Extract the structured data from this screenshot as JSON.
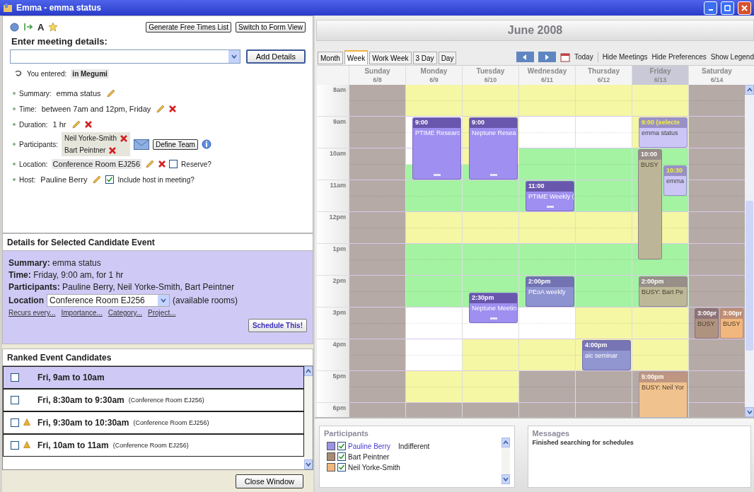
{
  "window": {
    "title": "Emma - emma status"
  },
  "toolbar": {
    "glyph": "A",
    "buttons": [
      "Generate Free Times List",
      "Switch to Form View"
    ]
  },
  "entry": {
    "heading": "Enter meeting details:",
    "button": "Add Details",
    "echo_label": "You entered:",
    "echo_value": "in Megumi"
  },
  "fields": [
    {
      "kind": "text",
      "label": "Summary:",
      "value": "emma status",
      "removable": false
    },
    {
      "kind": "text",
      "label": "Time:",
      "value": "between 7am and 12pm, Friday",
      "removable": true
    },
    {
      "kind": "text",
      "label": "Duration:",
      "value": "1 hr",
      "removable": true
    },
    {
      "kind": "participants",
      "label": "Participants:",
      "names": [
        "Neil Yorke-Smith",
        "Bart Peintner"
      ],
      "button": "Define Team"
    },
    {
      "kind": "location",
      "label": "Location:",
      "value": "Conference Room EJ256",
      "removable": true,
      "option": {
        "label": "Reserve?",
        "checked": false
      }
    },
    {
      "kind": "host",
      "label": "Host:",
      "value": "Pauline Berry",
      "removable": false,
      "option": {
        "label": "Include host in meeting?",
        "checked": true
      }
    }
  ],
  "details": {
    "title": "Details for Selected Candidate Event",
    "lines": [
      {
        "label": "Summary:",
        "value": "emma status"
      },
      {
        "label": "Time:",
        "value": "Friday, 9:00 am, for 1 hr"
      },
      {
        "label": "Participants:",
        "value": "Pauline Berry, Neil Yorke-Smith, Bart Peintner"
      }
    ],
    "location": {
      "label": "Location",
      "value": "Conference Room EJ256",
      "note": "(available rooms)"
    },
    "links": [
      "Recurs every...",
      "Importance...",
      "Category...",
      "Project..."
    ],
    "button": "Schedule This!"
  },
  "candidates": {
    "title": "Ranked Event Candidates",
    "items": [
      {
        "time": "Fri, 9am to 10am",
        "checked": false,
        "warning": false,
        "selected": true
      },
      {
        "time": "Fri, 8:30am to 9:30am",
        "room": "(Conference Room EJ256)",
        "checked": false,
        "warning": false,
        "selected": false
      },
      {
        "time": "Fri, 9:30am to 10:30am",
        "room": "(Conference Room EJ256)",
        "checked": false,
        "warning": true,
        "selected": false
      },
      {
        "time": "Fri, 10am to 11am",
        "room": "(Conference Room EJ256)",
        "checked": false,
        "warning": true,
        "selected": false
      }
    ],
    "button": "Close Window"
  },
  "calendar": {
    "title": "June 2008",
    "views": [
      {
        "label": "Month",
        "selected": false
      },
      {
        "label": "Week",
        "selected": true
      },
      {
        "label": "Work Week",
        "selected": false
      },
      {
        "label": "3 Day",
        "selected": false
      },
      {
        "label": "Day",
        "selected": false
      }
    ],
    "today": "Today",
    "actions": [
      "Hide Meetings",
      "Hide Preferences",
      "Show Legend"
    ],
    "hours": [
      "8am",
      "9am",
      "10am",
      "11am",
      "12pm",
      "1pm",
      "2pm",
      "3pm",
      "4pm",
      "5pm",
      "6pm"
    ],
    "days": [
      {
        "name": "Sunday",
        "date": "6/8",
        "selected": false,
        "slots": [
          {
            "kind": "unavailable"
          },
          {
            "kind": "unavailable"
          },
          {
            "kind": "unavailable"
          },
          {
            "kind": "unavailable"
          },
          {
            "kind": "unavailable"
          },
          {
            "kind": "unavailable"
          },
          {
            "kind": "unavailable"
          },
          {
            "kind": "unavailable"
          },
          {
            "kind": "unavailable"
          },
          {
            "kind": "unavailable"
          },
          {
            "kind": "unavailable"
          },
          {
            "kind": "unavailable"
          },
          {
            "kind": "unavailable"
          },
          {
            "kind": "unavailable"
          },
          {
            "kind": "unavailable"
          },
          {
            "kind": "unavailable"
          },
          {
            "kind": "unavailable"
          },
          {
            "kind": "unavailable"
          },
          {
            "kind": "unavailable"
          },
          {
            "kind": "unavailable"
          },
          {
            "kind": "unavailable"
          }
        ]
      },
      {
        "name": "Monday",
        "date": "6/9",
        "selected": false,
        "slots": [
          {
            "kind": "acceptable"
          },
          {
            "kind": "acceptable"
          },
          {
            "kind": "open",
            "events": [
              {
                "kind": "meeting",
                "time": "9:00",
                "text": "PTIME Researc",
                "color": "#9e8ff0"
              }
            ]
          },
          {
            "kind": "open",
            "events": [
              {
                "kind": "continued"
              }
            ]
          },
          {
            "kind": "open",
            "events": [
              {
                "kind": "continued"
              }
            ]
          },
          {
            "kind": "preferred",
            "events": [
              {
                "kind": "continued"
              }
            ]
          },
          {
            "kind": "preferred"
          },
          {
            "kind": "preferred"
          },
          {
            "kind": "acceptable"
          },
          {
            "kind": "acceptable"
          },
          {
            "kind": "preferred"
          },
          {
            "kind": "preferred"
          },
          {
            "kind": "preferred"
          },
          {
            "kind": "preferred"
          },
          {
            "kind": "open"
          },
          {
            "kind": "open"
          },
          {
            "kind": "open"
          },
          {
            "kind": "open"
          },
          {
            "kind": "acceptable"
          },
          {
            "kind": "acceptable"
          },
          {
            "kind": "unavailable"
          }
        ]
      },
      {
        "name": "Tuesday",
        "date": "6/10",
        "selected": false,
        "slots": [
          {
            "kind": "acceptable"
          },
          {
            "kind": "acceptable"
          },
          {
            "kind": "acceptable",
            "events": [
              {
                "kind": "meeting",
                "time": "9:00",
                "text": "Neptune Resea",
                "color": "#9e8ff0"
              }
            ]
          },
          {
            "kind": "acceptable",
            "events": [
              {
                "kind": "continued"
              }
            ]
          },
          {
            "kind": "acceptable",
            "events": [
              {
                "kind": "continued"
              }
            ]
          },
          {
            "kind": "preferred",
            "events": [
              {
                "kind": "continued"
              }
            ]
          },
          {
            "kind": "preferred"
          },
          {
            "kind": "preferred"
          },
          {
            "kind": "acceptable"
          },
          {
            "kind": "acceptable"
          },
          {
            "kind": "preferred"
          },
          {
            "kind": "preferred"
          },
          {
            "kind": "preferred"
          },
          {
            "kind": "preferred",
            "events": [
              {
                "kind": "meeting",
                "time": "2:30pm",
                "text": "Neptune Meetin",
                "color": "#9e8ff0"
              }
            ]
          },
          {
            "kind": "open",
            "events": [
              {
                "kind": "continued"
              }
            ]
          },
          {
            "kind": "open"
          },
          {
            "kind": "acceptable"
          },
          {
            "kind": "acceptable"
          },
          {
            "kind": "acceptable"
          },
          {
            "kind": "acceptable"
          },
          {
            "kind": "unavailable"
          }
        ]
      },
      {
        "name": "Wednesday",
        "date": "6/11",
        "selected": false,
        "slots": [
          {
            "kind": "acceptable"
          },
          {
            "kind": "acceptable"
          },
          {
            "kind": "open"
          },
          {
            "kind": "open"
          },
          {
            "kind": "preferred"
          },
          {
            "kind": "preferred"
          },
          {
            "kind": "preferred",
            "events": [
              {
                "kind": "meeting",
                "time": "11:00",
                "text": "PTIME Weekly (",
                "color": "#9e8ff0"
              }
            ]
          },
          {
            "kind": "preferred",
            "events": [
              {
                "kind": "continued"
              }
            ]
          },
          {
            "kind": "acceptable"
          },
          {
            "kind": "acceptable"
          },
          {
            "kind": "preferred"
          },
          {
            "kind": "preferred"
          },
          {
            "kind": "preferred",
            "events": [
              {
                "kind": "tentative",
                "time": "2:00pm",
                "text": "PEoA weekly",
                "color": "#8d92d0"
              }
            ]
          },
          {
            "kind": "preferred",
            "events": [
              {
                "kind": "continued"
              }
            ]
          },
          {
            "kind": "open"
          },
          {
            "kind": "open"
          },
          {
            "kind": "acceptable"
          },
          {
            "kind": "acceptable"
          },
          {
            "kind": "unavailable"
          },
          {
            "kind": "unavailable"
          },
          {
            "kind": "unavailable"
          }
        ]
      },
      {
        "name": "Thursday",
        "date": "6/12",
        "selected": false,
        "slots": [
          {
            "kind": "acceptable"
          },
          {
            "kind": "acceptable"
          },
          {
            "kind": "open"
          },
          {
            "kind": "open"
          },
          {
            "kind": "preferred"
          },
          {
            "kind": "preferred"
          },
          {
            "kind": "preferred"
          },
          {
            "kind": "preferred"
          },
          {
            "kind": "acceptable"
          },
          {
            "kind": "acceptable"
          },
          {
            "kind": "preferred"
          },
          {
            "kind": "preferred"
          },
          {
            "kind": "preferred"
          },
          {
            "kind": "preferred"
          },
          {
            "kind": "acceptable"
          },
          {
            "kind": "acceptable"
          },
          {
            "kind": "acceptable",
            "events": [
              {
                "kind": "tentative",
                "time": "4:00pm",
                "text": "aic seminar",
                "color": "#9296d0"
              }
            ]
          },
          {
            "kind": "acceptable",
            "events": [
              {
                "kind": "continued"
              }
            ]
          },
          {
            "kind": "unavailable"
          },
          {
            "kind": "unavailable"
          },
          {
            "kind": "unavailable"
          }
        ]
      },
      {
        "name": "Friday",
        "date": "6/13",
        "selected": true,
        "slots": [
          {
            "kind": "acceptable"
          },
          {
            "kind": "acceptable"
          },
          {
            "kind": "acceptable",
            "events": [
              {
                "kind": "candidate",
                "time": "9:00 (selecte",
                "text": "emma status",
                "color": "#cbc6f5"
              }
            ]
          },
          {
            "kind": "acceptable",
            "events": [
              {
                "kind": "continued"
              }
            ]
          },
          {
            "kind": "preferred",
            "events": [
              {
                "kind": "busy",
                "time": "10:00",
                "text": "BUSY",
                "color": "#bdb597",
                "narrow": true
              }
            ]
          },
          {
            "kind": "preferred",
            "events": [
              {
                "kind": "continued"
              },
              {
                "kind": "candidate",
                "time": "10:30",
                "text": "emma",
                "color": "#cbc6f5",
                "narrow": true
              }
            ]
          },
          {
            "kind": "preferred",
            "events": [
              {
                "kind": "continued"
              },
              {
                "kind": "continued"
              }
            ]
          },
          {
            "kind": "preferred",
            "events": [
              {
                "kind": "continued"
              }
            ]
          },
          {
            "kind": "acceptable",
            "events": [
              {
                "kind": "continued"
              }
            ]
          },
          {
            "kind": "acceptable",
            "events": [
              {
                "kind": "continued"
              }
            ]
          },
          {
            "kind": "preferred",
            "events": [
              {
                "kind": "continued"
              }
            ]
          },
          {
            "kind": "preferred"
          },
          {
            "kind": "preferred",
            "events": [
              {
                "kind": "busy",
                "time": "2:00pm",
                "text": "BUSY: Bart Pe",
                "color": "#bdb897"
              }
            ]
          },
          {
            "kind": "preferred",
            "events": [
              {
                "kind": "continued"
              }
            ]
          },
          {
            "kind": "acceptable"
          },
          {
            "kind": "acceptable"
          },
          {
            "kind": "acceptable"
          },
          {
            "kind": "acceptable"
          },
          {
            "kind": "unavailable",
            "events": [
              {
                "kind": "busy",
                "time": "5:00pm",
                "text": "BUSY: Neil Yor",
                "color": "#f0c28e"
              }
            ]
          },
          {
            "kind": "unavailable",
            "events": [
              {
                "kind": "continued"
              }
            ]
          },
          {
            "kind": "unavailable",
            "events": [
              {
                "kind": "continued"
              }
            ]
          }
        ]
      },
      {
        "name": "Saturday",
        "date": "6/14",
        "selected": false,
        "slots": [
          {
            "kind": "unavailable"
          },
          {
            "kind": "unavailable"
          },
          {
            "kind": "unavailable"
          },
          {
            "kind": "unavailable"
          },
          {
            "kind": "unavailable"
          },
          {
            "kind": "unavailable"
          },
          {
            "kind": "unavailable"
          },
          {
            "kind": "unavailable"
          },
          {
            "kind": "unavailable"
          },
          {
            "kind": "unavailable"
          },
          {
            "kind": "unavailable"
          },
          {
            "kind": "unavailable"
          },
          {
            "kind": "unavailable"
          },
          {
            "kind": "unavailable"
          },
          {
            "kind": "unavailable",
            "events": [
              {
                "kind": "busy",
                "time": "3:00pr",
                "text": "BUSY",
                "color": "#b0937f",
                "narrow": true
              },
              {
                "kind": "busy",
                "time": "3:00pr",
                "text": "BUSY",
                "color": "#f2b77c",
                "narrow": true
              }
            ]
          },
          {
            "kind": "unavailable",
            "events": [
              {
                "kind": "continued"
              },
              {
                "kind": "continued"
              }
            ]
          },
          {
            "kind": "unavailable"
          },
          {
            "kind": "unavailable"
          },
          {
            "kind": "unavailable"
          },
          {
            "kind": "unavailable"
          },
          {
            "kind": "unavailable"
          }
        ]
      }
    ]
  },
  "participants": {
    "title": "Participants",
    "items": [
      {
        "name": "Pauline Berry",
        "color": "#9b94e6",
        "checked": true,
        "selected": true,
        "preference": "Indifferent"
      },
      {
        "name": "Bart Peintner",
        "color": "#a88b72",
        "checked": true,
        "selected": false
      },
      {
        "name": "Neil Yorke-Smith",
        "color": "#f2b77c",
        "checked": true,
        "selected": false
      }
    ]
  },
  "messages": {
    "title": "Messages",
    "lines": [
      "Finished searching for schedules"
    ]
  }
}
